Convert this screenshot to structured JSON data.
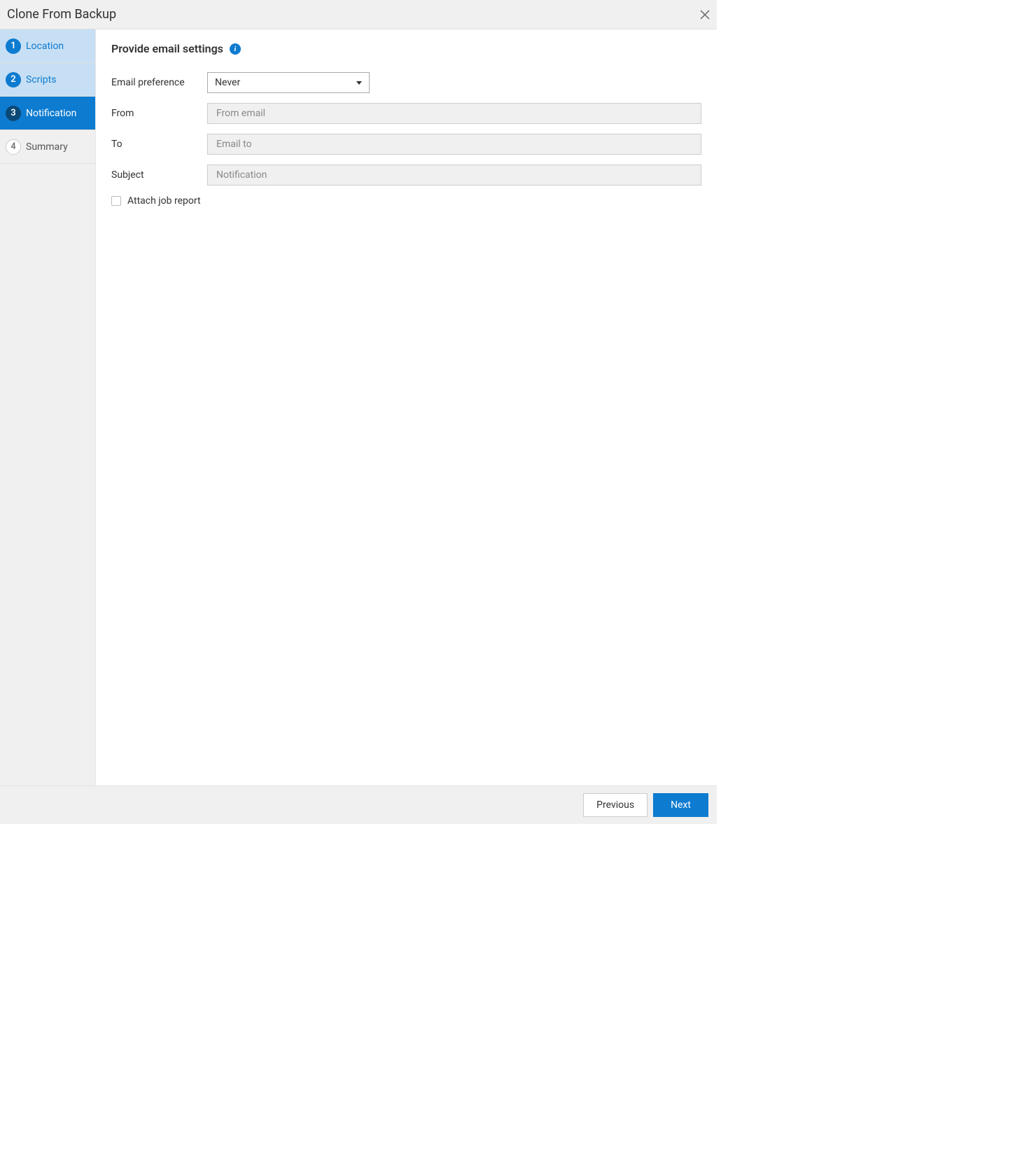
{
  "header": {
    "title": "Clone From Backup"
  },
  "sidebar": {
    "steps": [
      {
        "number": "1",
        "label": "Location",
        "state": "completed"
      },
      {
        "number": "2",
        "label": "Scripts",
        "state": "completed"
      },
      {
        "number": "3",
        "label": "Notification",
        "state": "active"
      },
      {
        "number": "4",
        "label": "Summary",
        "state": "pending"
      }
    ]
  },
  "content": {
    "title": "Provide email settings",
    "info_icon": "i",
    "fields": {
      "email_preference": {
        "label": "Email preference",
        "value": "Never"
      },
      "from": {
        "label": "From",
        "placeholder": "From email",
        "value": ""
      },
      "to": {
        "label": "To",
        "placeholder": "Email to",
        "value": ""
      },
      "subject": {
        "label": "Subject",
        "placeholder": "Notification",
        "value": ""
      },
      "attach_report": {
        "label": "Attach job report",
        "checked": false
      }
    }
  },
  "footer": {
    "previous_label": "Previous",
    "next_label": "Next"
  }
}
